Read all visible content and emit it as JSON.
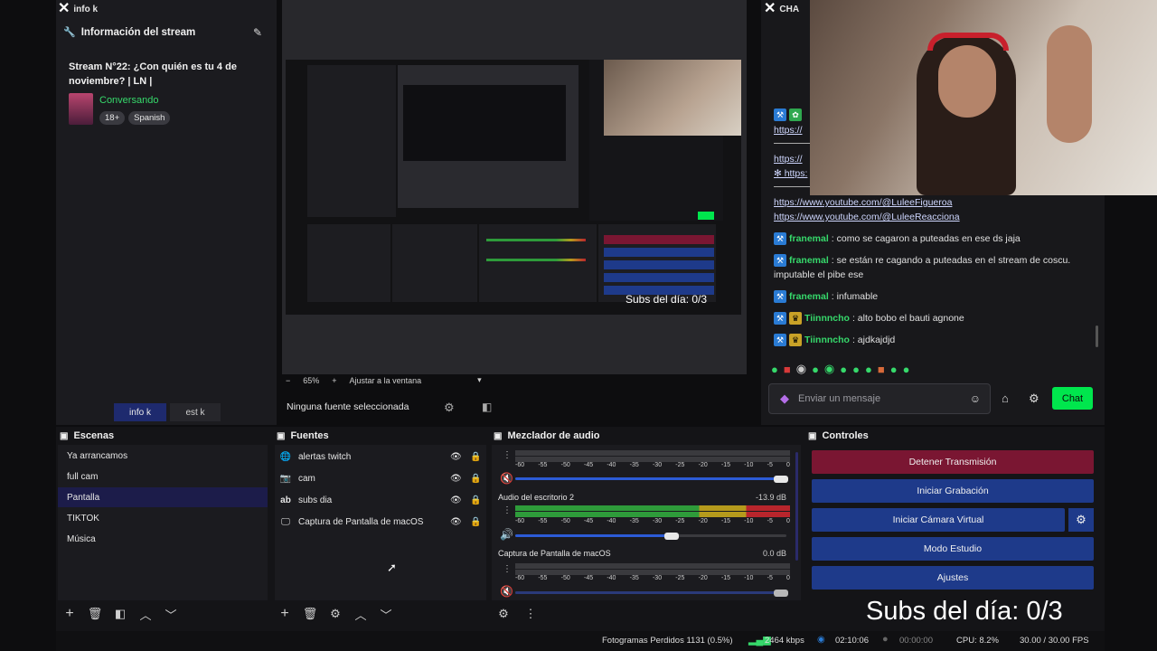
{
  "info_dock": {
    "title": "info k",
    "section_title": "Información del stream",
    "stream_title": "Stream N°22: ¿Con quién es tu 4 de noviembre? | LN |",
    "category": "Conversando",
    "tags": [
      "18+",
      "Spanish"
    ],
    "tabs": [
      "info k",
      "est k"
    ]
  },
  "preview": {
    "zoom_minus": "−",
    "zoom": "65%",
    "zoom_plus": "+",
    "fit_label": "Ajustar a la ventana",
    "subs_overlay_small": "Subs del día: 0/3",
    "no_source": "Ninguna fuente seleccionada"
  },
  "chat_dock": {
    "title": "CHA",
    "messages": [
      {
        "user": "",
        "text": "https://www.youtube.com/@LuleeFigueroa",
        "type": "link"
      },
      {
        "user": "",
        "text": "https://www.youtube.com/@LuleeReacciona",
        "type": "link"
      },
      {
        "user": "franemal",
        "text": ": como se cagaron a puteadas en ese ds jaja",
        "type": "msg"
      },
      {
        "user": "franemal",
        "text": ": se están re cagando a puteadas en el stream de coscu.",
        "type": "msg"
      },
      {
        "user": "",
        "text": "imputable el pibe ese",
        "type": "cont"
      },
      {
        "user": "franemal",
        "text": ": infumable",
        "type": "msg"
      },
      {
        "user": "Tiinnncho",
        "text": ": alto bobo el bauti agnone",
        "type": "msg"
      },
      {
        "user": "Tiinnncho",
        "text": ": ajdkajdjd",
        "type": "msg"
      }
    ],
    "partial_links": [
      "https://",
      "https://",
      "✻ https:"
    ],
    "input_placeholder": "Enviar un mensaje",
    "chat_button": "Chat"
  },
  "scenes": {
    "title": "Escenas",
    "items": [
      "Ya arrancamos",
      "full cam",
      "Pantalla",
      "TIKTOK",
      "Música"
    ],
    "selected_index": 2
  },
  "sources": {
    "title": "Fuentes",
    "items": [
      {
        "label": "alertas twitch",
        "icon": "globe-icon"
      },
      {
        "label": "cam",
        "icon": "camera-icon"
      },
      {
        "label": "subs dia",
        "icon": "text-icon"
      },
      {
        "label": "Captura de Pantalla de macOS",
        "icon": "monitor-icon"
      }
    ]
  },
  "mixer": {
    "title": "Mezclador de audio",
    "ticks": [
      "-60",
      "-55",
      "-50",
      "-45",
      "-40",
      "-35",
      "-30",
      "-25",
      "-20",
      "-15",
      "-10",
      "-5",
      "0"
    ],
    "channels": [
      {
        "name": "",
        "db": "",
        "volume": 1.0,
        "muted": true
      },
      {
        "name": "Audio del escritorio 2",
        "db": "-13.9 dB",
        "volume": 0.58,
        "muted": false
      },
      {
        "name": "Captura de Pantalla de macOS",
        "db": "0.0 dB",
        "volume": 1.0,
        "muted": true
      }
    ]
  },
  "controls": {
    "title": "Controles",
    "buttons": [
      "Detener Transmisión",
      "Iniciar Grabación",
      "Iniciar Cámara Virtual",
      "Modo Estudio",
      "Ajustes"
    ]
  },
  "overlay": {
    "subs_text": "Subs del día: 0/3"
  },
  "status_bar": {
    "dropped": "Fotogramas Perdidos 1131 (0.5%)",
    "bitrate": "2464 kbps",
    "stream_time": "02:10:06",
    "rec_time": "00:00:00",
    "cpu": "CPU: 8.2%",
    "fps": "30.00 / 30.00 FPS"
  },
  "colors": {
    "accent_blue": "#1e3a8a",
    "stop_red": "#7a1632",
    "twitch_green": "#00e64d",
    "meter_green": "#2e9b3a",
    "meter_yellow": "#b59a1c",
    "meter_red": "#b8252c"
  }
}
